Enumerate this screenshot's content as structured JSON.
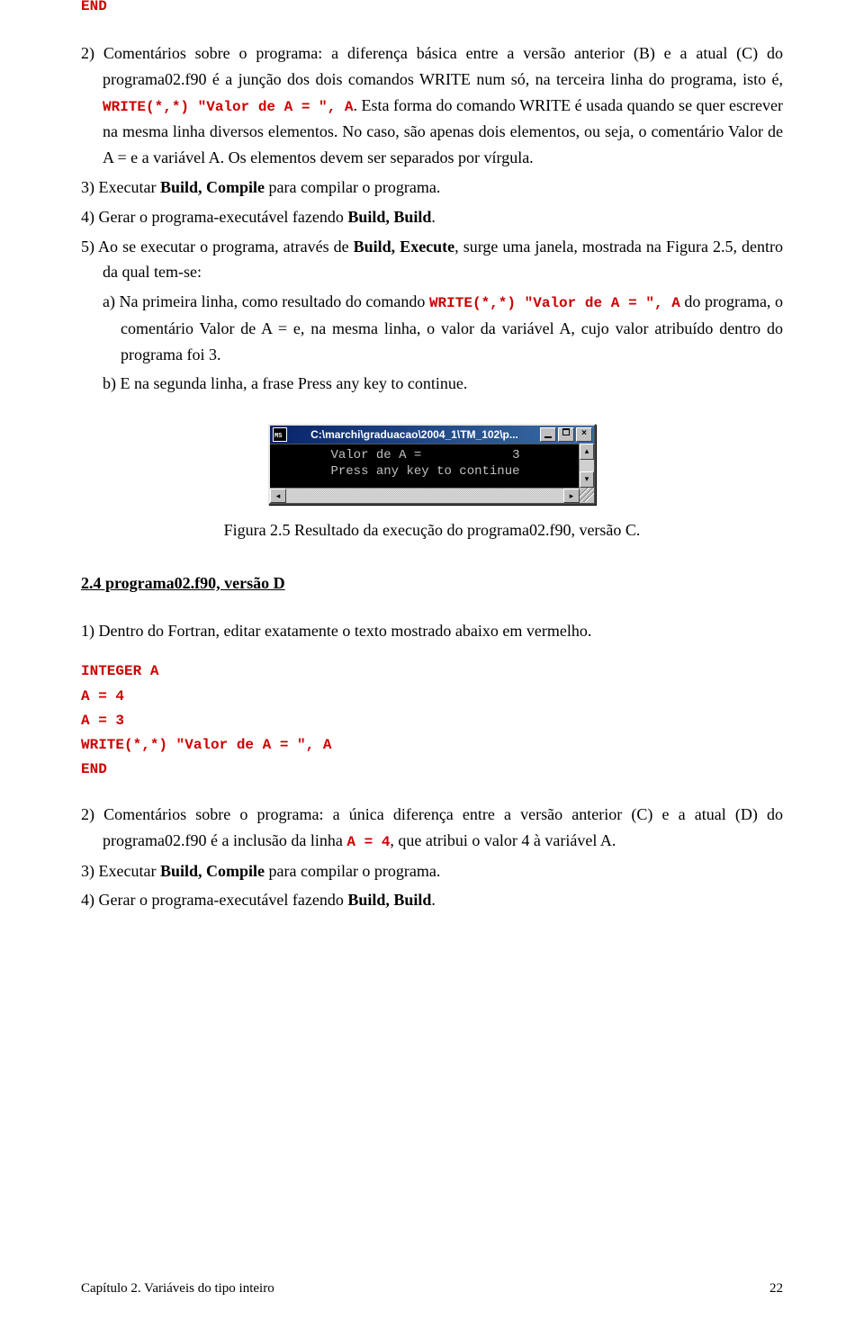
{
  "codeTop": "END",
  "para2_prefix": "2) Comentários sobre o programa: a diferença básica entre a versão anterior (B) e a atual (C) do programa02.f90 é a junção dos dois comandos WRITE num só, na terceira linha do programa, isto é, ",
  "para2_code": "WRITE(*,*) \"Valor de A = \", A",
  "para2_suffix": ". Esta forma do comando WRITE é usada quando se quer escrever na mesma linha diversos elementos. No caso, são apenas dois elementos, ou seja, o comentário Valor de A = e a variável A. Os elementos devem ser separados por vírgula.",
  "item3_pre": "3) Executar ",
  "item3_bold": "Build, Compile",
  "item3_post": " para compilar o programa.",
  "item4_pre": "4) Gerar o programa-executável fazendo ",
  "item4_bold": "Build, Build",
  "item4_post": ".",
  "item5_pre": "5) Ao se executar o programa, através de ",
  "item5_bold": "Build, Execute",
  "item5_post": ", surge uma janela, mostrada na Figura 2.5, dentro da qual tem-se:",
  "sub_a_pre": "a) Na primeira linha, como resultado do comando ",
  "sub_a_code": "WRITE(*,*) \"Valor de A = \", A",
  "sub_a_post": " do programa, o comentário Valor de A = e, na mesma linha, o valor da variável A, cujo valor atribuído dentro do programa foi 3.",
  "sub_b": "b) E na segunda linha, a frase Press any key to continue.",
  "console": {
    "title": "C:\\marchi\\graduacao\\2004_1\\TM_102\\p...",
    "line1": "Valor de A =            3",
    "line2": "Press any key to continue"
  },
  "figCaption": "Figura 2.5 Resultado da execução do programa02.f90, versão C.",
  "section24": "2.4 programa02.f90, versão D",
  "d_item1": "1) Dentro do Fortran, editar exatamente o texto mostrado abaixo em vermelho.",
  "codeD": {
    "l1": "INTEGER A",
    "l2": "A = 4",
    "l3": "A = 3",
    "l4": "WRITE(*,*) \"Valor de A = \", A",
    "l5": "END"
  },
  "d_item2_pre": "2) Comentários sobre o programa: a única diferença entre a versão anterior (C) e a atual (D) do programa02.f90 é a inclusão da linha ",
  "d_item2_code": "A = 4",
  "d_item2_post": ", que atribui o valor 4 à variável A.",
  "d_item3_pre": "3) Executar ",
  "d_item3_bold": "Build, Compile",
  "d_item3_post": " para compilar o programa.",
  "d_item4_pre": "4) Gerar o programa-executável fazendo ",
  "d_item4_bold": "Build, Build",
  "d_item4_post": ".",
  "footerLeft": "Capítulo 2. Variáveis do tipo inteiro",
  "footerRight": "22"
}
